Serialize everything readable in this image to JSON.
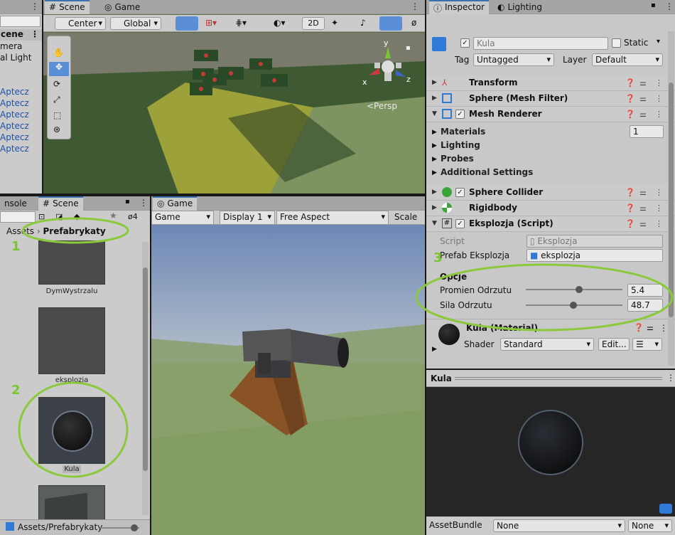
{
  "hierarchy": {
    "items": [
      "cene",
      "mera",
      "al Light",
      "Aptecz",
      "Aptecz",
      "Aptecz",
      "Aptecz",
      "Aptecz",
      "Aptecz"
    ]
  },
  "scene_view": {
    "tabs": [
      "Scene",
      "Game"
    ],
    "toolbar": {
      "pivot": "Center",
      "space": "Global",
      "mode_2d": "2D"
    },
    "persp_label": "<Persp",
    "gizmo_axes": {
      "x": "x",
      "y": "y",
      "z": "z"
    }
  },
  "project": {
    "tabs": [
      "nsole",
      "Scene"
    ],
    "hidden_count": "4",
    "breadcrumb": {
      "root": "Assets",
      "current": "Prefabrykaty"
    },
    "assets": [
      {
        "name": "DymWystrzalu"
      },
      {
        "name": "eksplozja"
      },
      {
        "name": "Kula"
      },
      {
        "name": ""
      }
    ],
    "footer_path": "Assets/Prefabrykaty",
    "annotations": [
      "1",
      "2"
    ]
  },
  "game_view": {
    "tab": "Game",
    "toolbar": {
      "mode": "Game",
      "display": "Display 1",
      "aspect": "Free Aspect",
      "scale": "Scale"
    }
  },
  "inspector": {
    "tabs": [
      "Inspector",
      "Lighting"
    ],
    "object_name": "Kula",
    "static_label": "Static",
    "tag_label": "Tag",
    "tag_value": "Untagged",
    "layer_label": "Layer",
    "layer_value": "Default",
    "components": {
      "transform": "Transform",
      "mesh_filter": "Sphere (Mesh Filter)",
      "mesh_renderer": "Mesh Renderer",
      "sphere_collider": "Sphere Collider",
      "rigidbody": "Rigidbody",
      "eksplozja": "Eksplozja (Script)"
    },
    "renderer_sections": {
      "materials": "Materials",
      "materials_count": "1",
      "lighting": "Lighting",
      "probes": "Probes",
      "additional": "Additional Settings"
    },
    "script": {
      "script_label": "Script",
      "script_value": "Eksplozja",
      "prefab_label": "Prefab Eksplozja",
      "prefab_value": "eksplozja",
      "options_header": "Opcje",
      "radius_label": "Promien Odrzutu",
      "radius_value": "5.4",
      "radius_fraction": 0.55,
      "force_label": "Sila Odrzutu",
      "force_value": "48.7",
      "force_fraction": 0.49
    },
    "material": {
      "name": "Kula (Material)",
      "shader_label": "Shader",
      "shader_value": "Standard",
      "edit_label": "Edit..."
    },
    "annotation": "3",
    "preview_title": "Kula",
    "assetbundle_label": "AssetBundle",
    "assetbundle_value": "None",
    "assetbundle_variant": "None"
  }
}
